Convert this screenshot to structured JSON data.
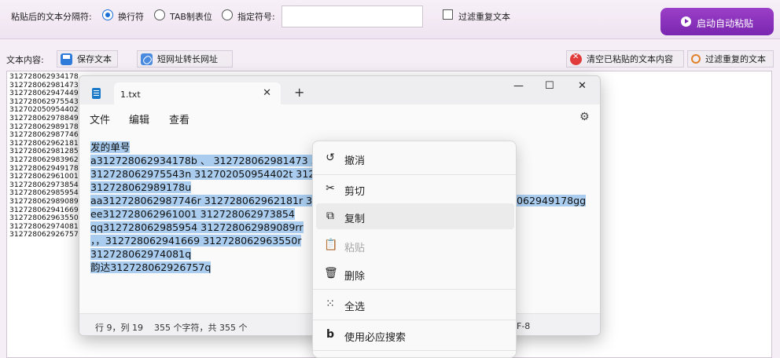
{
  "topbar": {
    "separator_label": "粘贴后的文本分隔符:",
    "option_newline": "换行符",
    "option_tab": "TAB制表位",
    "option_custom": "指定符号:",
    "custom_value": "",
    "dedupe_label": "过滤重复文本",
    "start_button": "启动自动粘贴"
  },
  "toolbar": {
    "content_label": "文本内容:",
    "save_button": "保存文本",
    "url_button": "短网址转长网址",
    "clear_button": "清空已粘贴的文本内容",
    "filter_button": "过滤重复的文本"
  },
  "numbers": [
    "312728062934178",
    "312728062981473",
    "312728062947449",
    "312728062975543",
    "312702050954402",
    "312728062978849",
    "312728062989178",
    "312728062987746",
    "312728062962181",
    "312728062981285",
    "312728062983962",
    "312728062949178",
    "312728062961001",
    "312728062973854",
    "312728062985954",
    "312728062989089",
    "312728062941669",
    "312728062963550",
    "312728062974081",
    "312728062926757"
  ],
  "notepad": {
    "tab_title": "1.txt",
    "tab_close": "✕",
    "new_tab": "+",
    "minimize": "—",
    "maximize": "☐",
    "close": "✕",
    "menu_file": "文件",
    "menu_edit": "编辑",
    "menu_view": "查看",
    "lines": [
      "发的单号",
      "a312728062934178b 、 312728062981473 3127",
      "312728062975543n 312702050954402t 31272",
      "312728062989178u",
      "aa312728062987746r 312728062962181r 31272",
      "ee312728062961001 312728062973854",
      "qq312728062985954 312728062989089rr",
      "，，312728062941669 312728062963550r",
      "312728062974081q",
      "韵达312728062926757q"
    ],
    "line5_tail": "062949178gg",
    "status_pos": "行 9，列 19",
    "status_chars": "355 个字符，共 355 个",
    "status_enc": "F-8"
  },
  "context_menu": {
    "undo": "撤消",
    "cut": "剪切",
    "copy": "复制",
    "paste": "粘贴",
    "delete": "删除",
    "select_all": "全选",
    "bing_search": "使用必应搜索"
  }
}
